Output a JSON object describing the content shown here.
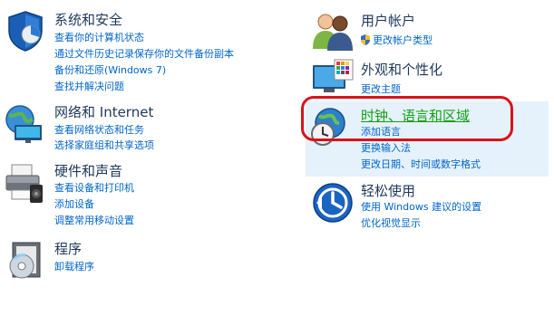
{
  "categories": {
    "system": {
      "title": "系统和安全",
      "links": [
        "查看你的计算机状态",
        "通过文件历史记录保存你的文件备份副本",
        "备份和还原(Windows 7)",
        "查找并解决问题"
      ]
    },
    "network": {
      "title": "网络和 Internet",
      "links": [
        "查看网络状态和任务",
        "选择家庭组和共享选项"
      ]
    },
    "hardware": {
      "title": "硬件和声音",
      "links": [
        "查看设备和打印机",
        "添加设备",
        "调整常用移动设置"
      ]
    },
    "programs": {
      "title": "程序",
      "links": [
        "卸载程序"
      ]
    },
    "accounts": {
      "title": "用户帐户",
      "links": [
        "更改帐户类型"
      ]
    },
    "appearance": {
      "title": "外观和个性化",
      "links": [
        "更改主题"
      ]
    },
    "clock": {
      "title": "时钟、语言和区域",
      "links": [
        "添加语言",
        "更换输入法",
        "更改日期、时间或数字格式"
      ]
    },
    "ease": {
      "title": "轻松使用",
      "links": [
        "使用 Windows 建议的设置",
        "优化视觉显示"
      ]
    }
  },
  "colors": {
    "title": "#1e395b",
    "link": "#0066cc",
    "hover_title": "#11a211",
    "highlight_bg": "#e5f1fb",
    "annotation": "#d9121b"
  }
}
